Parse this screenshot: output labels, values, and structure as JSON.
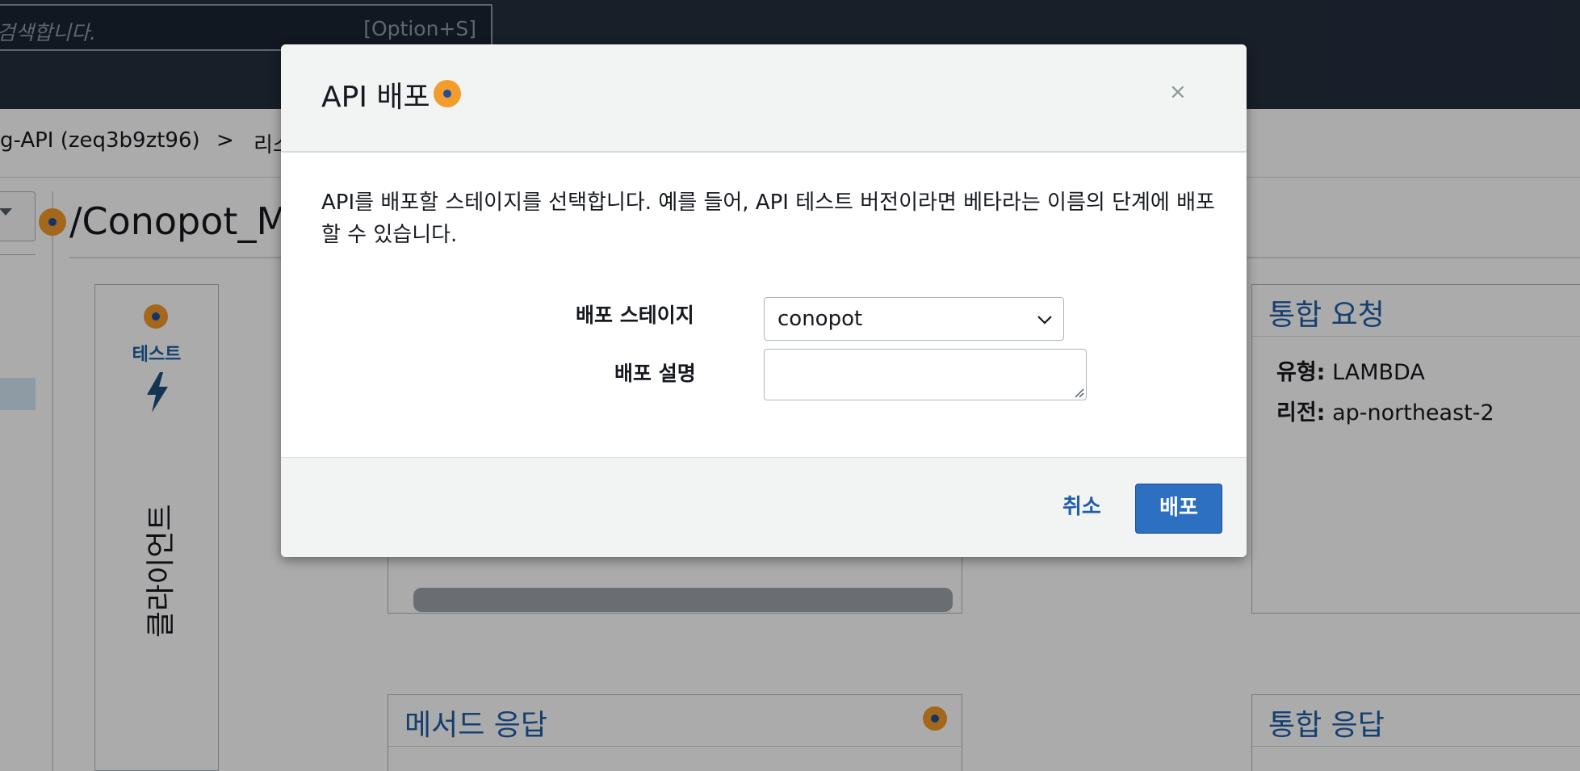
{
  "header": {
    "search_placeholder": "검색합니다.",
    "search_shortcut": "[Option+S]"
  },
  "breadcrumb": {
    "api": "g-API (zeq3b9zt96)",
    "separator": ">",
    "resources": "리소"
  },
  "resource": {
    "path_title": "/Conopot_Ma"
  },
  "client": {
    "test_label": "테스트",
    "vertical_label": "클라이언트"
  },
  "integration_request": {
    "title": "통합 요청",
    "type_label": "유형:",
    "type_value": "LAMBDA",
    "region_label": "리전:",
    "region_value": "ap-northeast-2"
  },
  "method_response": {
    "title": "메서드 응답"
  },
  "integration_response": {
    "title": "통합 응답"
  },
  "modal": {
    "title": "API 배포",
    "close": "×",
    "description": "API를 배포할 스테이지를 선택합니다. 예를 들어, API 테스트 버전이라면 베타라는 이름의 단계에 배포할 수 있습니다.",
    "stage_label": "배포 스테이지",
    "stage_value": "conopot",
    "desc_label": "배포 설명",
    "desc_value": "",
    "cancel_label": "취소",
    "deploy_label": "배포"
  },
  "colors": {
    "header_bg": "#232f3e",
    "link_blue": "#1f5ea8",
    "primary_button": "#2d6fc0",
    "info_dot": "#f39c2b"
  }
}
